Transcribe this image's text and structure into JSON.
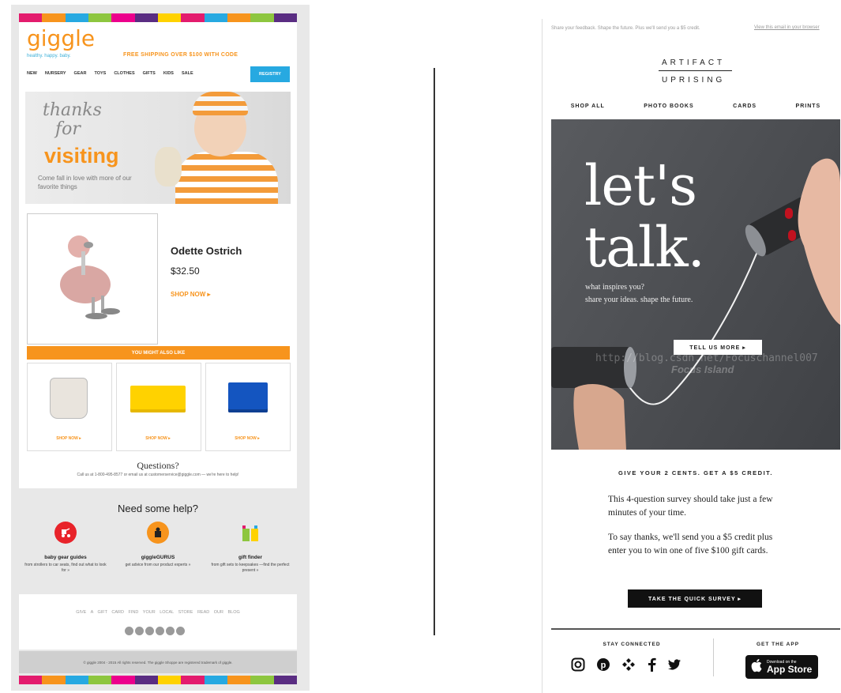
{
  "left": {
    "brand": "giggle",
    "tagline": "healthy. happy. baby.",
    "shipping": "FREE SHIPPING OVER $100 WITH CODE",
    "nav": [
      "NEW",
      "NURSERY",
      "GEAR",
      "TOYS",
      "CLOTHES",
      "GIFTS",
      "KIDS",
      "SALE"
    ],
    "register": "REGISTRY",
    "hero_thanks": "thanks",
    "hero_for": "for",
    "hero_visiting": "visiting",
    "hero_sub": "Come fall in love with more of our favorite things",
    "product_name": "Odette Ostrich",
    "product_price": "$32.50",
    "product_shop": "SHOP NOW ▸",
    "also_like": "YOU MIGHT ALSO LIKE",
    "also_items": [
      {
        "shop": "SHOP NOW ▸"
      },
      {
        "shop": "SHOP NOW ▸"
      },
      {
        "shop": "SHOP NOW ▸"
      }
    ],
    "questions_title": "Questions?",
    "questions_sub": "Call us at 1-800-495-8577 or email us at customerservice@giggle.com — we're here to help!",
    "help_title": "Need some help?",
    "help": [
      {
        "title": "baby gear guides",
        "text": "from strollers to car seats, find out what to look for »"
      },
      {
        "title": "giggleGURUS",
        "text": "get advice from our product experts »"
      },
      {
        "title": "gift finder",
        "text": "from gift sets to keepsakes —find the perfect present »"
      }
    ],
    "footer_links": "GIVE A GIFT CARD   FIND YOUR LOCAL STORE   READ OUR BLOG",
    "copyright": "© giggle 2004 - 2015 All rights reserved. The giggle Shoppe are registered trademark of giggle.",
    "stripe_colors": [
      "#e31b6d",
      "#f7941d",
      "#27a9e1",
      "#8dc63f",
      "#ec008c",
      "#5a2d82",
      "#ffd200",
      "#e31b6d",
      "#27a9e1",
      "#f7941d",
      "#8dc63f",
      "#5a2d82"
    ]
  },
  "right": {
    "top_left": "Share your feedback. Shape the future. Plus we'll send you a $5 credit.",
    "top_right": "View this email in your browser",
    "logo_line1": "ARTIFACT",
    "logo_line2": "UPRISING",
    "nav": [
      "SHOP ALL",
      "PHOTO BOOKS",
      "CARDS",
      "PRINTS"
    ],
    "hero_line1": "let's",
    "hero_line2": "talk.",
    "hero_sub1": "what inspires you?",
    "hero_sub2": "share your ideas. shape the future.",
    "tell_us": "TELL US MORE ▸",
    "watermark1": "http://blog.csdn.net/Focuschannel007",
    "watermark2": "Focus Island",
    "credit_title": "GIVE YOUR 2 CENTS. GET A $5 CREDIT.",
    "para1": "This 4-question survey should take just a few minutes of your time.",
    "para2": "To say thanks, we'll send you a $5 credit plus enter you to win one of five $100 gift cards.",
    "survey_button": "TAKE THE QUICK SURVEY ▸",
    "stay_connected": "STAY CONNECTED",
    "get_the_app": "GET THE APP",
    "app_small": "Download on the",
    "app_big": "App Store"
  }
}
